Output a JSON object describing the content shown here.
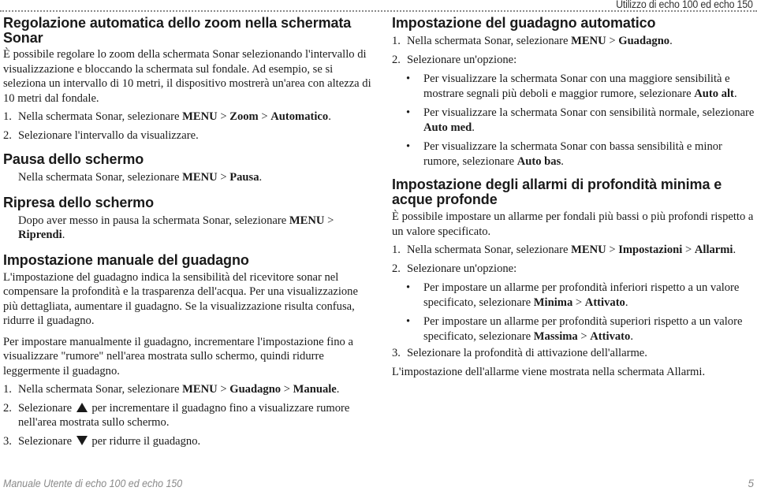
{
  "header": {
    "chapter_title": "Utilizzo di echo 100 ed echo 150"
  },
  "left_column": {
    "auto_zoom": {
      "title": "Regolazione automatica dello zoom nella schermata Sonar",
      "intro": "È possibile regolare lo zoom della schermata Sonar selezionando l'intervallo di visualizzazione e bloccando la schermata sul fondale. Ad esempio, se si seleziona un intervallo di 10 metri, il dispositivo mostrerà un'area con altezza di 10 metri dal fondale.",
      "steps": [
        {
          "num": "1.",
          "text": "Nella schermata Sonar, selezionare ",
          "menu": "MENU",
          "sep1": " > ",
          "item1": "Zoom",
          "sep2": " > ",
          "item2": "Automatico",
          "end": "."
        },
        {
          "num": "2.",
          "text": "Selezionare l'intervallo da visualizzare."
        }
      ]
    },
    "pause": {
      "title": "Pausa dello schermo",
      "text": "Nella schermata Sonar, selezionare ",
      "menu": "MENU",
      "sep": " > ",
      "item": "Pausa",
      "end": "."
    },
    "resume": {
      "title": "Ripresa dello schermo",
      "text": "Dopo aver messo in pausa la schermata Sonar, selezionare ",
      "menu": "MENU",
      "sep": " > ",
      "item": "Riprendi",
      "end": "."
    },
    "manual_gain": {
      "title": "Impostazione manuale del guadagno",
      "para1": "L'impostazione del guadagno indica la sensibilità del ricevitore sonar nel compensare la profondità e la trasparenza dell'acqua. Per una visualizzazione più dettagliata, aumentare il guadagno. Se la visualizzazione risulta confusa, ridurre il guadagno.",
      "para2": "Per impostare manualmente il guadagno, incrementare l'impostazione fino a visualizzare \"rumore\" nell'area mostrata sullo schermo, quindi ridurre leggermente il guadagno.",
      "steps": [
        {
          "num": "1.",
          "text": "Nella schermata Sonar, selezionare ",
          "menu": "MENU",
          "sep1": " > ",
          "item1": "Guadagno",
          "sep2": " > ",
          "item2": "Manuale",
          "end": "."
        },
        {
          "num": "2.",
          "text_before": "Selezionare ",
          "icon": "triangle-up-icon",
          "text_after": " per incrementare il guadagno fino a visualizzare rumore nell'area mostrata sullo schermo."
        },
        {
          "num": "3.",
          "text_before": "Selezionare ",
          "icon": "triangle-down-icon",
          "text_after": " per ridurre il guadagno."
        }
      ]
    }
  },
  "right_column": {
    "auto_gain": {
      "title": "Impostazione del guadagno automatico",
      "steps": [
        {
          "num": "1.",
          "text": "Nella schermata Sonar, selezionare ",
          "menu": "MENU",
          "sep": " > ",
          "item": "Guadagno",
          "end": "."
        },
        {
          "num": "2.",
          "text": "Selezionare un'opzione:"
        }
      ],
      "options": [
        {
          "bullet": "•",
          "text": "Per visualizzare la schermata Sonar con una maggiore sensibilità e mostrare segnali più deboli e maggior rumore, selezionare ",
          "bold": "Auto alt",
          "end": "."
        },
        {
          "bullet": "•",
          "text": "Per visualizzare la schermata Sonar con sensibilità normale, selezionare ",
          "bold": "Auto med",
          "end": "."
        },
        {
          "bullet": "•",
          "text": "Per visualizzare la schermata Sonar con bassa sensibilità e minor rumore, selezionare ",
          "bold": "Auto bas",
          "end": "."
        }
      ]
    },
    "alarms": {
      "title": "Impostazione degli allarmi di profondità minima e acque profonde",
      "intro": "È possibile impostare un allarme per fondali più bassi o più profondi rispetto a un valore specificato.",
      "steps": [
        {
          "num": "1.",
          "text": "Nella schermata Sonar, selezionare ",
          "menu": "MENU",
          "sep1": " > ",
          "item1": "Impostazioni",
          "sep2": " > ",
          "item2": "Allarmi",
          "end": "."
        },
        {
          "num": "2.",
          "text": "Selezionare un'opzione:"
        }
      ],
      "options": [
        {
          "bullet": "•",
          "text": "Per impostare un allarme per profondità inferiori rispetto a un valore specificato, selezionare ",
          "bold1": "Minima",
          "sep": " > ",
          "bold2": "Attivato",
          "end": "."
        },
        {
          "bullet": "•",
          "text": "Per impostare un allarme per profondità superiori rispetto a un valore specificato, selezionare ",
          "bold1": "Massima",
          "sep": " > ",
          "bold2": "Attivato",
          "end": "."
        }
      ],
      "step3": {
        "num": "3.",
        "text": "Selezionare la profondità di attivazione dell'allarme."
      },
      "outro": "L'impostazione dell'allarme viene mostrata nella schermata Allarmi."
    }
  },
  "footer": {
    "manual_title": "Manuale Utente di echo 100 ed echo 150",
    "page_number": "5"
  }
}
